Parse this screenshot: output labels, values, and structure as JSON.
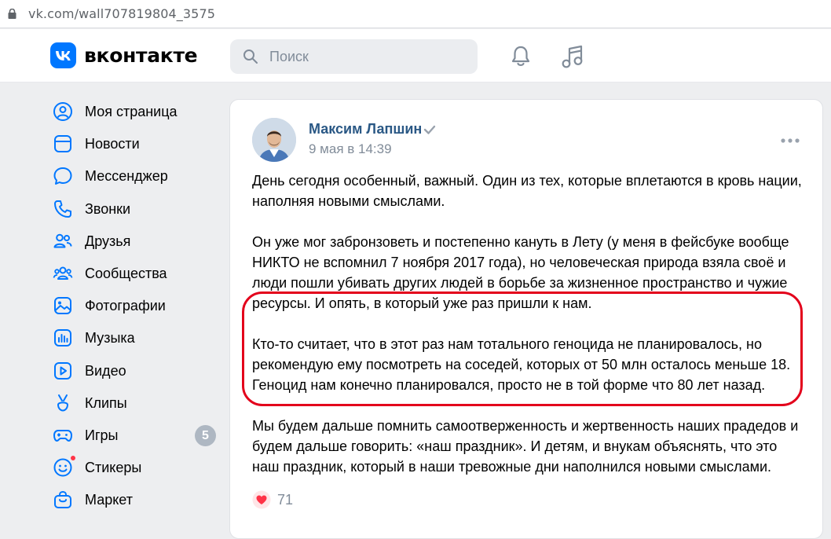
{
  "browser": {
    "url": "vk.com/wall707819804_3575"
  },
  "header": {
    "logo_text": "вконтакте",
    "search_placeholder": "Поиск"
  },
  "sidebar": {
    "items": [
      {
        "label": "Моя страница",
        "icon": "user-circle-icon"
      },
      {
        "label": "Новости",
        "icon": "news-icon"
      },
      {
        "label": "Мессенджер",
        "icon": "message-icon"
      },
      {
        "label": "Звонки",
        "icon": "phone-icon"
      },
      {
        "label": "Друзья",
        "icon": "friends-icon"
      },
      {
        "label": "Сообщества",
        "icon": "communities-icon"
      },
      {
        "label": "Фотографии",
        "icon": "photo-icon"
      },
      {
        "label": "Музыка",
        "icon": "music-chart-icon"
      },
      {
        "label": "Видео",
        "icon": "video-icon"
      },
      {
        "label": "Клипы",
        "icon": "clips-icon"
      },
      {
        "label": "Игры",
        "icon": "gamepad-icon",
        "badge": "5"
      },
      {
        "label": "Стикеры",
        "icon": "sticker-icon"
      },
      {
        "label": "Маркет",
        "icon": "market-icon"
      }
    ]
  },
  "post": {
    "author": "Максим Лапшин",
    "date": "9 мая в 14:39",
    "paragraphs": [
      "День сегодня особенный, важный. Один из тех, которые вплетаются в кровь нации, наполняя новыми смыслами.",
      "Он уже мог забронзоветь и постепенно кануть в Лету (у меня в фейсбуке вообще НИКТО не вспомнил 7 ноября 2017 года), но человеческая природа взяла своё и люди пошли убивать других людей в борьбе за жизненное пространство и чужие ресурсы. И опять, в который уже раз пришли к нам.",
      "Кто-то считает, что в этот раз нам тотального геноцида не планировалось, но рекомендую ему посмотреть на соседей, которых от 50 млн осталось меньше 18. Геноцид нам конечно планировался, просто не в той форме что 80 лет назад.",
      "Мы будем дальше помнить самоотверженность и жертвенность наших прадедов и будем дальше говорить: «наш праздник». И детям, и внукам объяснять, что это наш праздник, который в наши тревожные дни наполнился новыми смыслами."
    ],
    "likes": "71"
  },
  "colors": {
    "brand": "#0077ff",
    "link": "#2a5885",
    "secondary_text": "#818c99",
    "highlight": "#e3001b",
    "like": "#ff3347"
  }
}
